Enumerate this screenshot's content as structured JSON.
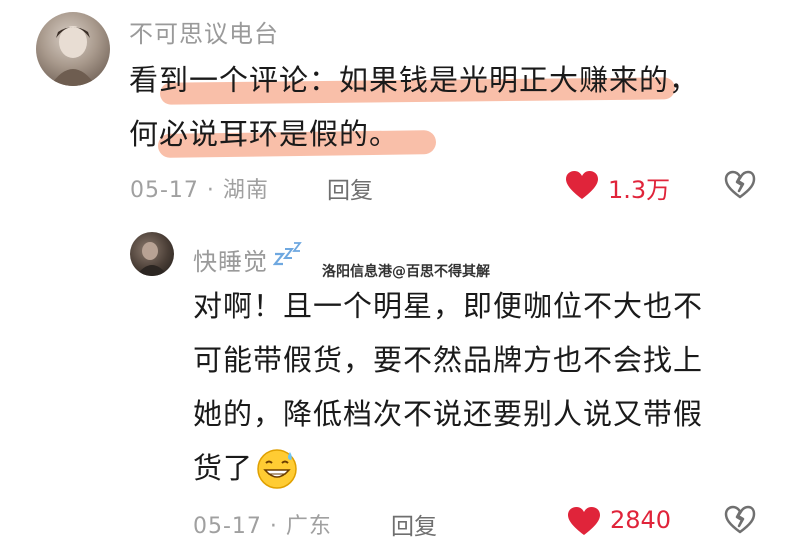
{
  "comment1": {
    "username": "不可思议电台",
    "text_line1": "看到一个评论：如果钱是光明正大赚来的，",
    "text_line2": "何必说耳环是假的。",
    "date_location": "05-17 · 湖南",
    "reply_label": "回复",
    "likes": "1.3万"
  },
  "comment2": {
    "username": "快睡觉",
    "text_lines": [
      "对啊！且一个明星，即便咖位不大也不",
      "可能带假货，要不然品牌方也不会找上",
      "她的，降低档次不说还要别人说又带假",
      "货了"
    ],
    "date_location": "05-17 · 广东",
    "reply_label": "回复",
    "likes": "2840"
  },
  "watermark": "洛阳信息港@百思不得其解",
  "colors": {
    "like_red": "#e0243a",
    "highlight": "#f48a63",
    "meta_gray": "#a0a0a0"
  },
  "icons": [
    "heart-icon",
    "broken-heart-icon",
    "zzz-icon",
    "grin-sweat-emoji"
  ]
}
